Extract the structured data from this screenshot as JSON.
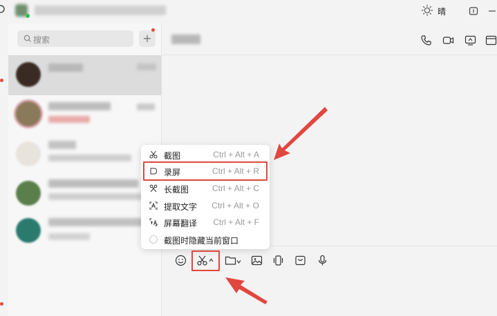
{
  "topbar": {
    "weather_text": "晴",
    "weather_icon": "sun-icon"
  },
  "sidebar": {
    "search_placeholder": "搜索",
    "add_button": "+"
  },
  "context_menu": {
    "items": [
      {
        "icon": "scissors-icon",
        "label": "截图",
        "shortcut": "Ctrl + Alt + A"
      },
      {
        "icon": "record-screen-icon",
        "label": "录屏",
        "shortcut": "Ctrl + Alt + R"
      },
      {
        "icon": "long-screenshot-icon",
        "label": "长截图",
        "shortcut": "Ctrl + Alt + C"
      },
      {
        "icon": "extract-text-icon",
        "label": "提取文字",
        "shortcut": "Ctrl + Alt + O"
      },
      {
        "icon": "translate-screen-icon",
        "label": "屏幕翻译",
        "shortcut": "Ctrl + Alt + F"
      }
    ],
    "option_label": "截图时隐藏当前窗口",
    "option_checked": false
  },
  "toolbar": {
    "tools": [
      "emoji-icon",
      "scissors-icon",
      "folder-icon",
      "image-icon",
      "vibrate-icon",
      "favorites-box-icon",
      "microphone-icon"
    ]
  },
  "chat_header": {
    "icons": [
      "phone-icon",
      "video-call-icon",
      "screen-share-icon",
      "more-window-icon"
    ]
  },
  "colors": {
    "highlight": "#e0473f",
    "arrow": "#e0473f",
    "unread_dot": "#e5483d"
  }
}
